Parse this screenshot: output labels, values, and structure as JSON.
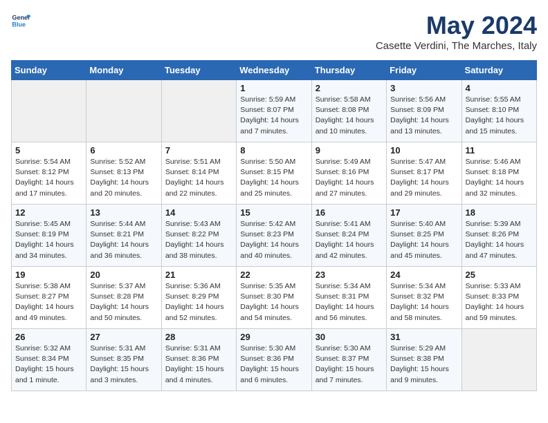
{
  "logo": {
    "text1": "General",
    "text2": "Blue"
  },
  "title": "May 2024",
  "subtitle": "Casette Verdini, The Marches, Italy",
  "days_of_week": [
    "Sunday",
    "Monday",
    "Tuesday",
    "Wednesday",
    "Thursday",
    "Friday",
    "Saturday"
  ],
  "weeks": [
    [
      {
        "day": "",
        "info": ""
      },
      {
        "day": "",
        "info": ""
      },
      {
        "day": "",
        "info": ""
      },
      {
        "day": "1",
        "sunrise": "Sunrise: 5:59 AM",
        "sunset": "Sunset: 8:07 PM",
        "daylight": "Daylight: 14 hours and 7 minutes."
      },
      {
        "day": "2",
        "sunrise": "Sunrise: 5:58 AM",
        "sunset": "Sunset: 8:08 PM",
        "daylight": "Daylight: 14 hours and 10 minutes."
      },
      {
        "day": "3",
        "sunrise": "Sunrise: 5:56 AM",
        "sunset": "Sunset: 8:09 PM",
        "daylight": "Daylight: 14 hours and 13 minutes."
      },
      {
        "day": "4",
        "sunrise": "Sunrise: 5:55 AM",
        "sunset": "Sunset: 8:10 PM",
        "daylight": "Daylight: 14 hours and 15 minutes."
      }
    ],
    [
      {
        "day": "5",
        "sunrise": "Sunrise: 5:54 AM",
        "sunset": "Sunset: 8:12 PM",
        "daylight": "Daylight: 14 hours and 17 minutes."
      },
      {
        "day": "6",
        "sunrise": "Sunrise: 5:52 AM",
        "sunset": "Sunset: 8:13 PM",
        "daylight": "Daylight: 14 hours and 20 minutes."
      },
      {
        "day": "7",
        "sunrise": "Sunrise: 5:51 AM",
        "sunset": "Sunset: 8:14 PM",
        "daylight": "Daylight: 14 hours and 22 minutes."
      },
      {
        "day": "8",
        "sunrise": "Sunrise: 5:50 AM",
        "sunset": "Sunset: 8:15 PM",
        "daylight": "Daylight: 14 hours and 25 minutes."
      },
      {
        "day": "9",
        "sunrise": "Sunrise: 5:49 AM",
        "sunset": "Sunset: 8:16 PM",
        "daylight": "Daylight: 14 hours and 27 minutes."
      },
      {
        "day": "10",
        "sunrise": "Sunrise: 5:47 AM",
        "sunset": "Sunset: 8:17 PM",
        "daylight": "Daylight: 14 hours and 29 minutes."
      },
      {
        "day": "11",
        "sunrise": "Sunrise: 5:46 AM",
        "sunset": "Sunset: 8:18 PM",
        "daylight": "Daylight: 14 hours and 32 minutes."
      }
    ],
    [
      {
        "day": "12",
        "sunrise": "Sunrise: 5:45 AM",
        "sunset": "Sunset: 8:19 PM",
        "daylight": "Daylight: 14 hours and 34 minutes."
      },
      {
        "day": "13",
        "sunrise": "Sunrise: 5:44 AM",
        "sunset": "Sunset: 8:21 PM",
        "daylight": "Daylight: 14 hours and 36 minutes."
      },
      {
        "day": "14",
        "sunrise": "Sunrise: 5:43 AM",
        "sunset": "Sunset: 8:22 PM",
        "daylight": "Daylight: 14 hours and 38 minutes."
      },
      {
        "day": "15",
        "sunrise": "Sunrise: 5:42 AM",
        "sunset": "Sunset: 8:23 PM",
        "daylight": "Daylight: 14 hours and 40 minutes."
      },
      {
        "day": "16",
        "sunrise": "Sunrise: 5:41 AM",
        "sunset": "Sunset: 8:24 PM",
        "daylight": "Daylight: 14 hours and 42 minutes."
      },
      {
        "day": "17",
        "sunrise": "Sunrise: 5:40 AM",
        "sunset": "Sunset: 8:25 PM",
        "daylight": "Daylight: 14 hours and 45 minutes."
      },
      {
        "day": "18",
        "sunrise": "Sunrise: 5:39 AM",
        "sunset": "Sunset: 8:26 PM",
        "daylight": "Daylight: 14 hours and 47 minutes."
      }
    ],
    [
      {
        "day": "19",
        "sunrise": "Sunrise: 5:38 AM",
        "sunset": "Sunset: 8:27 PM",
        "daylight": "Daylight: 14 hours and 49 minutes."
      },
      {
        "day": "20",
        "sunrise": "Sunrise: 5:37 AM",
        "sunset": "Sunset: 8:28 PM",
        "daylight": "Daylight: 14 hours and 50 minutes."
      },
      {
        "day": "21",
        "sunrise": "Sunrise: 5:36 AM",
        "sunset": "Sunset: 8:29 PM",
        "daylight": "Daylight: 14 hours and 52 minutes."
      },
      {
        "day": "22",
        "sunrise": "Sunrise: 5:35 AM",
        "sunset": "Sunset: 8:30 PM",
        "daylight": "Daylight: 14 hours and 54 minutes."
      },
      {
        "day": "23",
        "sunrise": "Sunrise: 5:34 AM",
        "sunset": "Sunset: 8:31 PM",
        "daylight": "Daylight: 14 hours and 56 minutes."
      },
      {
        "day": "24",
        "sunrise": "Sunrise: 5:34 AM",
        "sunset": "Sunset: 8:32 PM",
        "daylight": "Daylight: 14 hours and 58 minutes."
      },
      {
        "day": "25",
        "sunrise": "Sunrise: 5:33 AM",
        "sunset": "Sunset: 8:33 PM",
        "daylight": "Daylight: 14 hours and 59 minutes."
      }
    ],
    [
      {
        "day": "26",
        "sunrise": "Sunrise: 5:32 AM",
        "sunset": "Sunset: 8:34 PM",
        "daylight": "Daylight: 15 hours and 1 minute."
      },
      {
        "day": "27",
        "sunrise": "Sunrise: 5:31 AM",
        "sunset": "Sunset: 8:35 PM",
        "daylight": "Daylight: 15 hours and 3 minutes."
      },
      {
        "day": "28",
        "sunrise": "Sunrise: 5:31 AM",
        "sunset": "Sunset: 8:36 PM",
        "daylight": "Daylight: 15 hours and 4 minutes."
      },
      {
        "day": "29",
        "sunrise": "Sunrise: 5:30 AM",
        "sunset": "Sunset: 8:36 PM",
        "daylight": "Daylight: 15 hours and 6 minutes."
      },
      {
        "day": "30",
        "sunrise": "Sunrise: 5:30 AM",
        "sunset": "Sunset: 8:37 PM",
        "daylight": "Daylight: 15 hours and 7 minutes."
      },
      {
        "day": "31",
        "sunrise": "Sunrise: 5:29 AM",
        "sunset": "Sunset: 8:38 PM",
        "daylight": "Daylight: 15 hours and 9 minutes."
      },
      {
        "day": "",
        "info": ""
      }
    ]
  ]
}
